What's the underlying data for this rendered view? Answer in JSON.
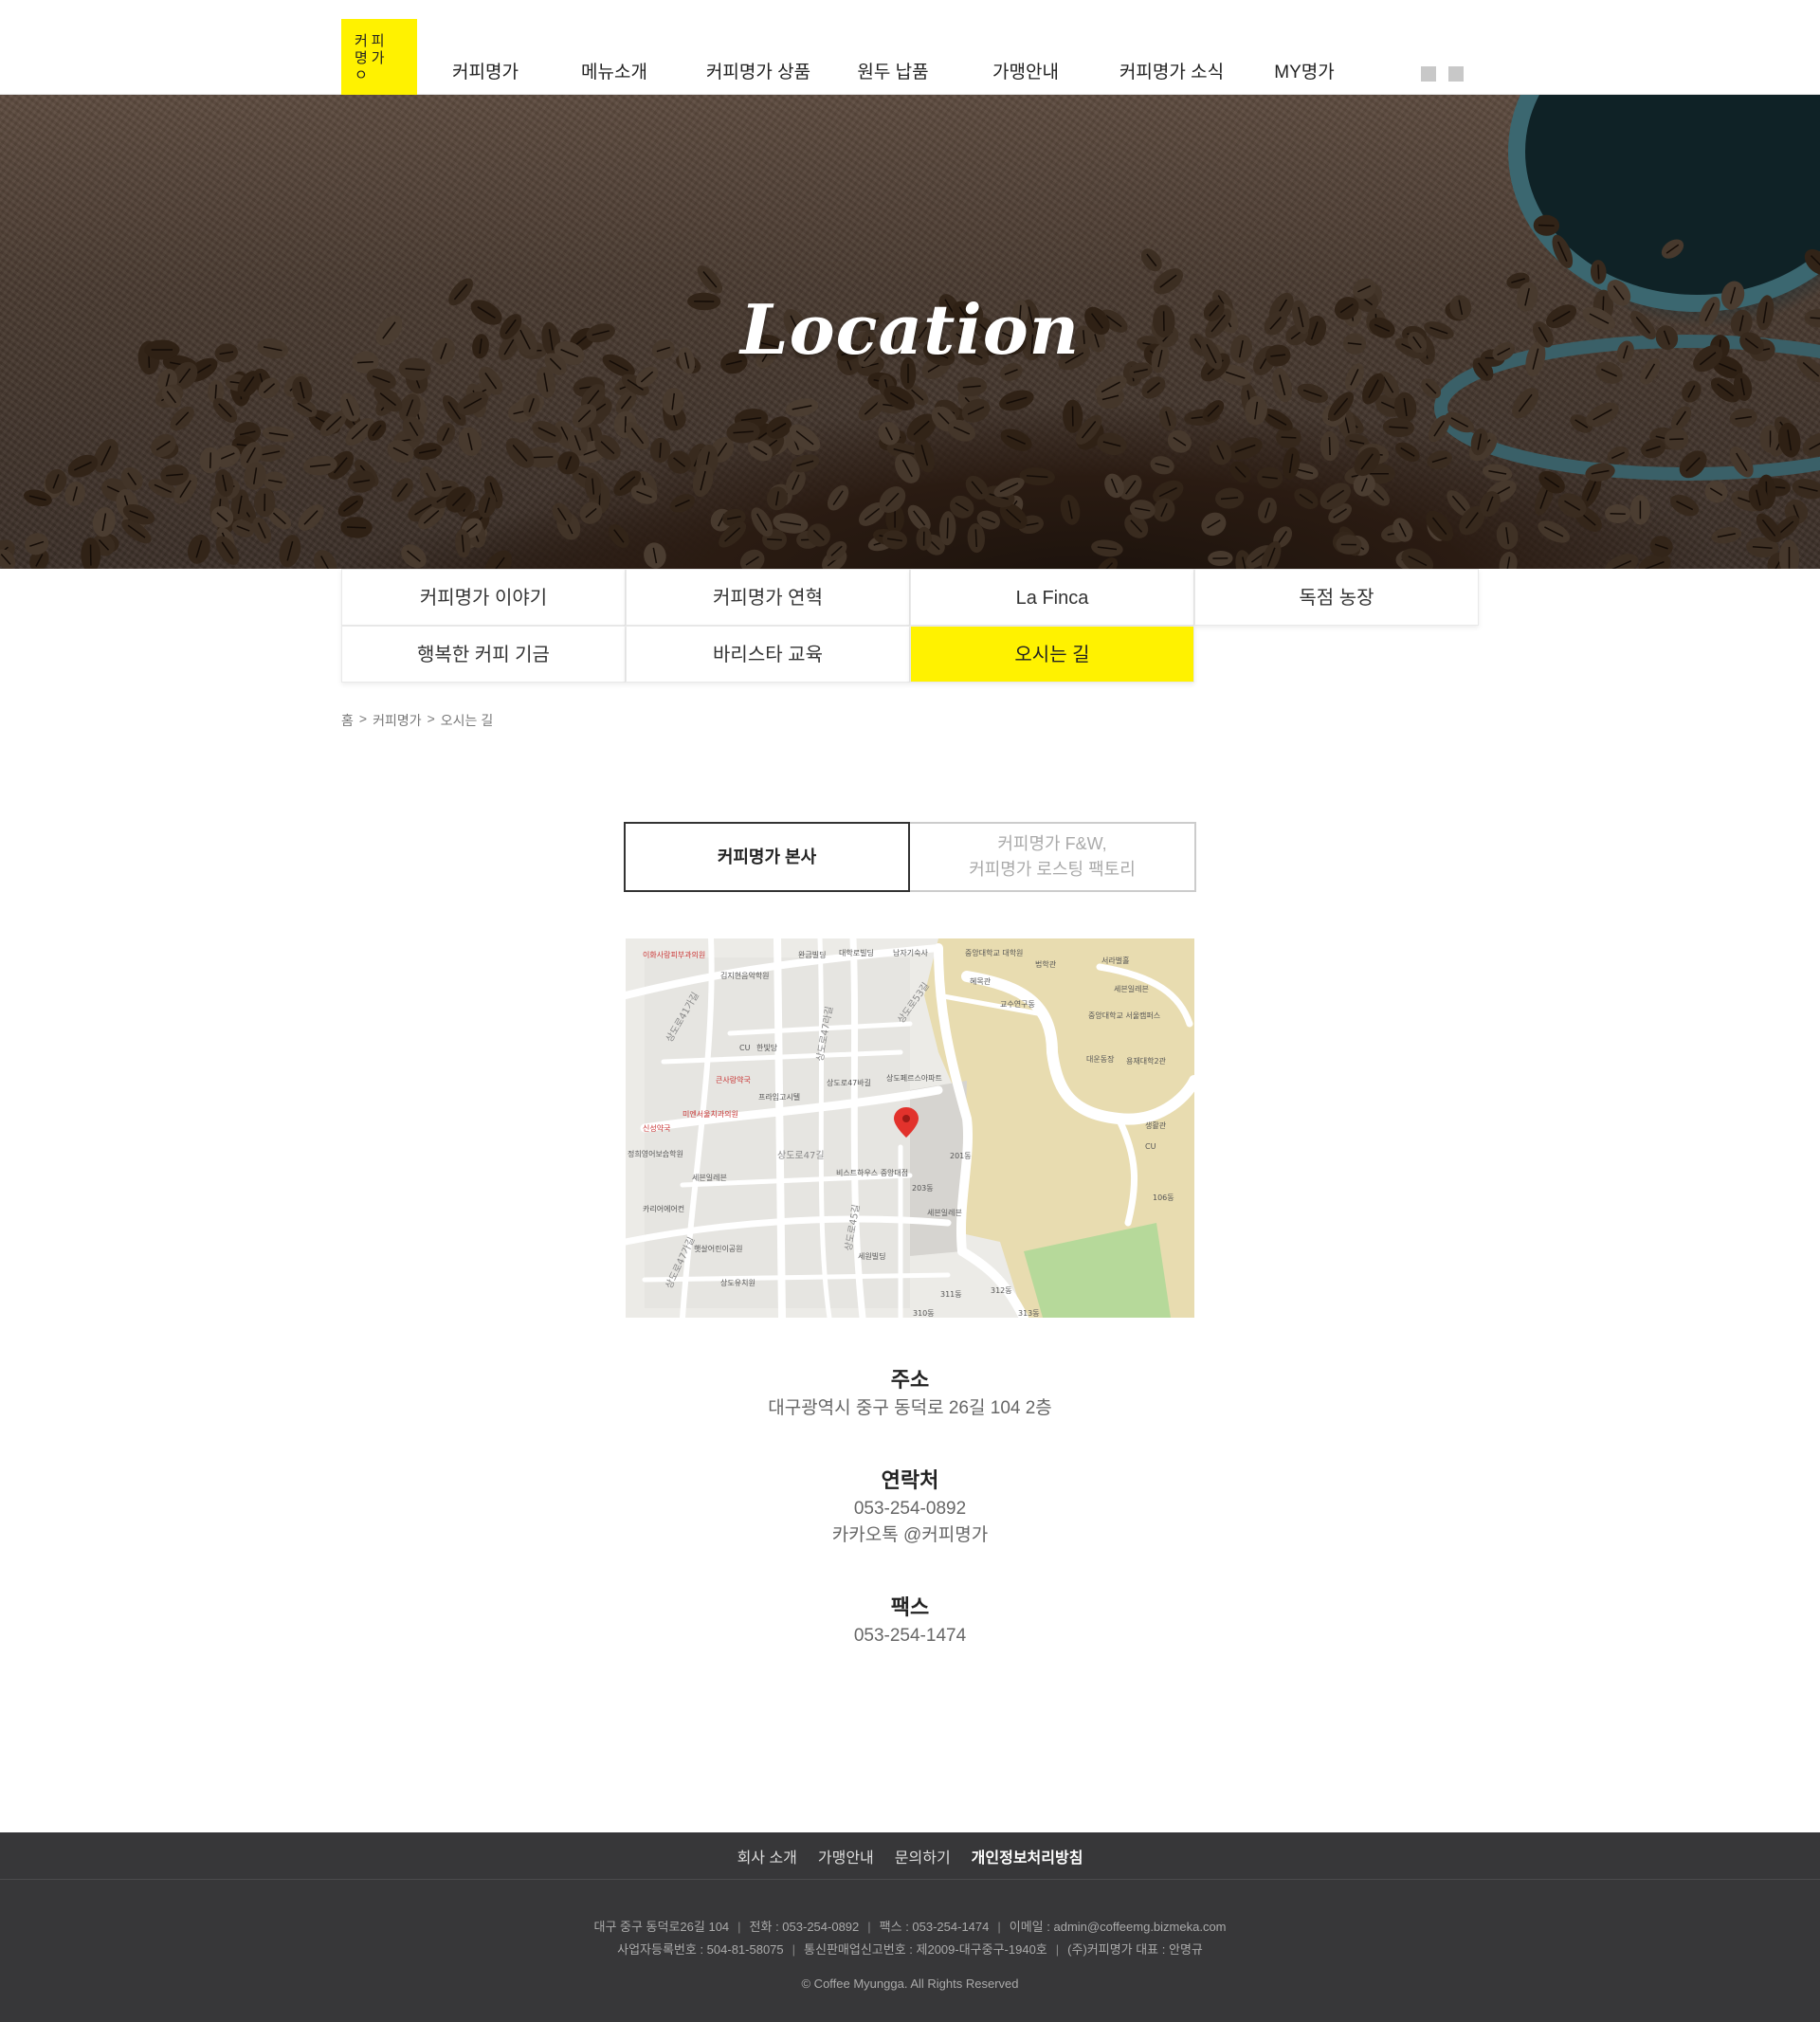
{
  "logo": {
    "lines": [
      "커피",
      "명가",
      "ㅇ"
    ]
  },
  "nav": {
    "items": [
      "커피명가",
      "메뉴소개",
      "커피명가 상품",
      "원두 납품",
      "가맹안내",
      "커피명가 소식",
      "MY명가"
    ]
  },
  "hero": {
    "title": "Location"
  },
  "subnav": {
    "items": [
      "커피명가 이야기",
      "커피명가 연혁",
      "La Finca",
      "독점 농장",
      "행복한 커피 기금",
      "바리스타 교육",
      "오시는 길"
    ],
    "active": "오시는 길"
  },
  "breadcrumb": {
    "home": "홈",
    "sep": ">",
    "section": "커피명가",
    "current": "오시는 길"
  },
  "branch_tabs": {
    "tab1": "커피명가 본사",
    "tab2_line1": "커피명가 F&W,",
    "tab2_line2": "커피명가 로스팅 팩토리"
  },
  "map": {
    "labels": {
      "l1": "이화사랑피부과의원",
      "l2": "김지현음악학원",
      "l3": "완금빌딩",
      "l4": "대학로빌딩",
      "l5": "남자기숙사",
      "l6": "중앙대학교 대학원",
      "l7": "법학관",
      "l8": "서라벌홀",
      "l9": "혜목관",
      "l10": "세븐일레븐",
      "l11": "교수연구동",
      "l12": "중앙대학교 서울캠퍼스",
      "l13": "CU",
      "l14": "한빛당",
      "l15": "큰사랑약국",
      "l16": "상도로47바길",
      "l17": "상도페르스아파트",
      "l18": "대운동장",
      "l19": "용재대학2관",
      "l20": "프라임고시텔",
      "l21": "미엔서울치과의원",
      "l22": "신성약국",
      "l23": "상도로47길",
      "l24": "생활관",
      "l25": "정희영어보습학원",
      "l26": "세븐일레븐",
      "l27": "비스트하우스 중앙대점",
      "l28": "201동",
      "l29": "203동",
      "l30": "106동",
      "l31": "카리어에어컨",
      "l32": "세븐일레븐",
      "l33": "햇살어린이공원",
      "l34": "상도유치원",
      "l35": "세원빌딩",
      "l36": "311동",
      "l37": "312동",
      "l38": "310동",
      "l39": "313동",
      "l40": "상도로53길",
      "l41": "상도로41가길",
      "l42": "상도로45길",
      "l43": "상도로47라길",
      "l44": "상도로47가길",
      "l45": "CU"
    }
  },
  "info": {
    "address_head": "주소",
    "address": "대구광역시 중구 동덕로 26길 104 2층",
    "contact_head": "연락처",
    "phone": "053-254-0892",
    "kakao": "카카오톡 @커피명가",
    "fax_head": "팩스",
    "fax": "053-254-1474"
  },
  "footer": {
    "links": [
      "회사 소개",
      "가맹안내",
      "문의하기",
      "개인정보처리방침"
    ],
    "line1": [
      "대구 중구 동덕로26길 104",
      "전화 : 053-254-0892",
      "팩스 : 053-254-1474",
      "이메일 : admin@coffeemg.bizmeka.com"
    ],
    "line2": [
      "사업자등록번호 : 504-81-58075",
      "통신판매업신고번호 : 제2009-대구중구-1940호",
      "(주)커피명가 대표 : 안명규"
    ],
    "separator": "|",
    "copyright": "© Coffee Myungga. All Rights Reserved"
  },
  "colors": {
    "accent": "#fff200",
    "footer_bg": "#373739",
    "map_campus": "#e8dcb0",
    "map_park": "#b6d99a"
  }
}
